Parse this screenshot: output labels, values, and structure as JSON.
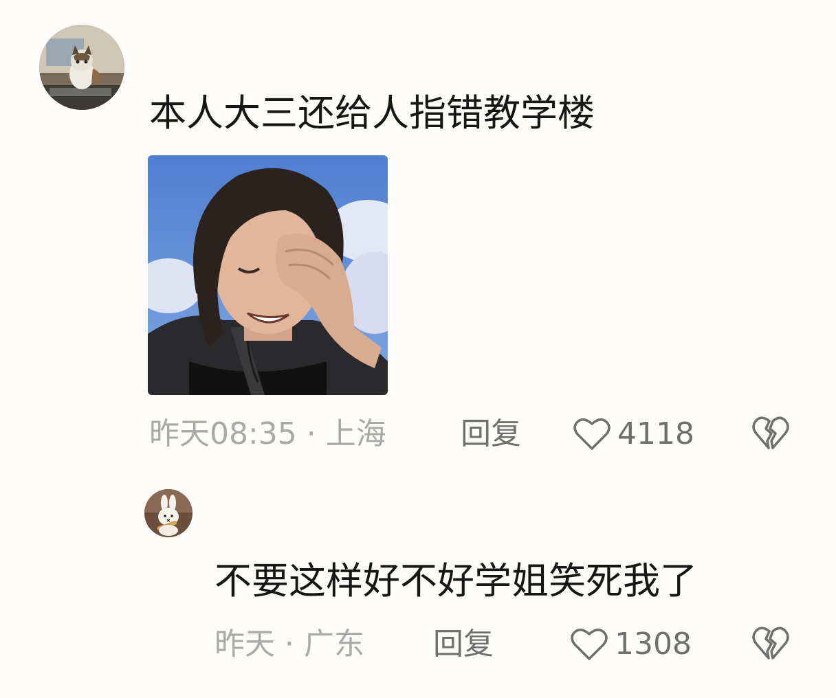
{
  "comments": [
    {
      "avatar_icon": "cat-avatar-icon",
      "text": "本人大三还给人指错教学楼",
      "attachment_icon": "laughing-man-facepalm-meme-image",
      "meta": "昨天08:35 · 上海",
      "reply_label": "回复",
      "like_count": "4118"
    },
    {
      "avatar_icon": "miffy-bunny-avatar-icon",
      "text": "不要这样好不好学姐笑死我了",
      "meta": "昨天 · 广东",
      "reply_label": "回复",
      "like_count": "1308"
    }
  ],
  "colors": {
    "background": "#fdfcf9",
    "text": "#161616",
    "meta": "#a9a9a9",
    "action": "#6f6f6f"
  }
}
